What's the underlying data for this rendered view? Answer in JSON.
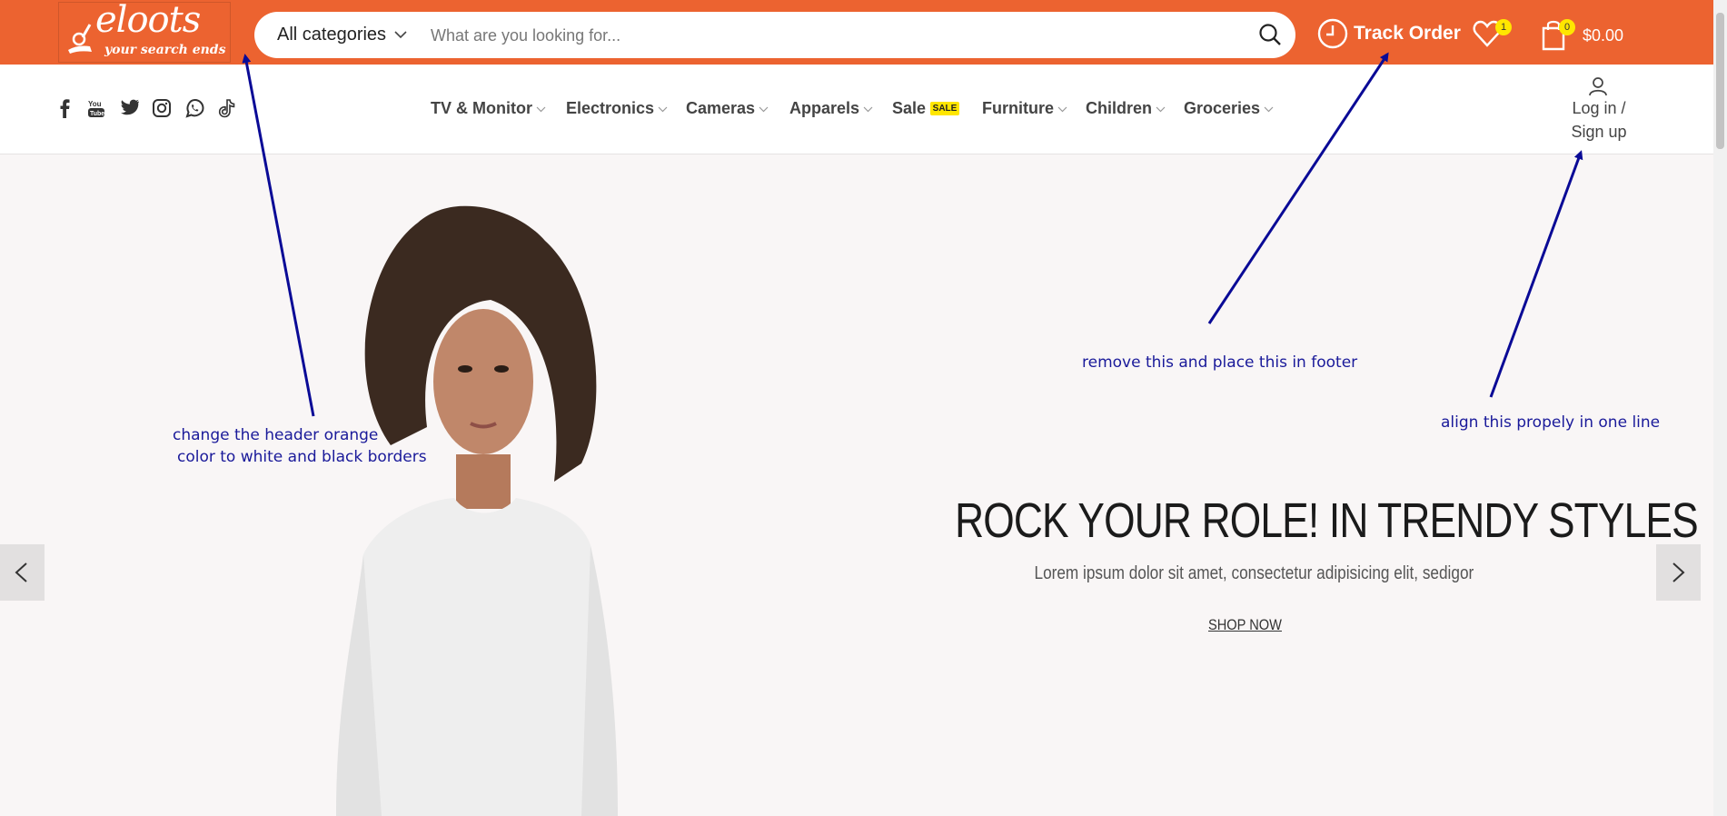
{
  "header": {
    "logo": {
      "word": "eloots",
      "tagline": "your search ends"
    },
    "search": {
      "category": "All categories",
      "placeholder": "What are you looking for..."
    },
    "track_order": "Track Order",
    "wishlist_count": "1",
    "cart_count": "0",
    "cart_total": "$0.00",
    "accent_color": "#ec6330"
  },
  "nav": {
    "social": [
      "facebook-icon",
      "youtube-icon",
      "twitter-icon",
      "instagram-icon",
      "whatsapp-icon",
      "tiktok-icon"
    ],
    "menu": [
      "TV & Monitor",
      "Electronics",
      "Cameras",
      "Apparels",
      "Sale",
      "Furniture",
      "Children",
      "Groceries"
    ],
    "sale_badge": "SALE",
    "login_line1": "Log in /",
    "login_line2": "Sign up"
  },
  "hero": {
    "title": "ROCK YOUR ROLE! IN TRENDY STYLES",
    "subtitle": "Lorem ipsum dolor sit amet, consectetur adipisicing elit, sedigor",
    "cta": "SHOP NOW"
  },
  "annotations": {
    "header_color_line1": "change the header orange",
    "header_color_line2": "color to white and black borders",
    "track_order": "remove this and place this in footer",
    "login_align": "align this propely in one line",
    "color": "#0a0a96"
  }
}
